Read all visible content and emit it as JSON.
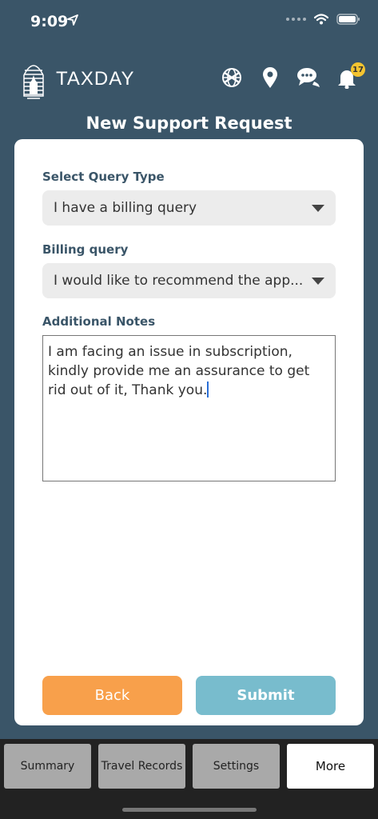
{
  "status": {
    "time": "9:09"
  },
  "header": {
    "brand": "TAXDAY",
    "icons": [
      "globe-icon",
      "location-pin-icon",
      "chat-icon",
      "bell-icon"
    ],
    "notification_count": "17"
  },
  "page": {
    "title": "New Support Request"
  },
  "form": {
    "query_type_label": "Select Query Type",
    "query_type_value": "I have a billing query",
    "billing_label": "Billing query",
    "billing_value": "I would like to recommend the app...",
    "notes_label": "Additional Notes",
    "notes_value": "I am facing an issue in subscription, kindly provide me an assurance to get rid out of it, Thank you."
  },
  "buttons": {
    "back": "Back",
    "submit": "Submit"
  },
  "tabs": [
    {
      "label": "Summary"
    },
    {
      "label": "Travel Records"
    },
    {
      "label": "Settings"
    },
    {
      "label": "More",
      "active": true
    }
  ],
  "colors": {
    "background": "#3a5568",
    "back_button": "#f8a04b",
    "submit_button": "#78bccd",
    "badge": "#f4c430"
  }
}
